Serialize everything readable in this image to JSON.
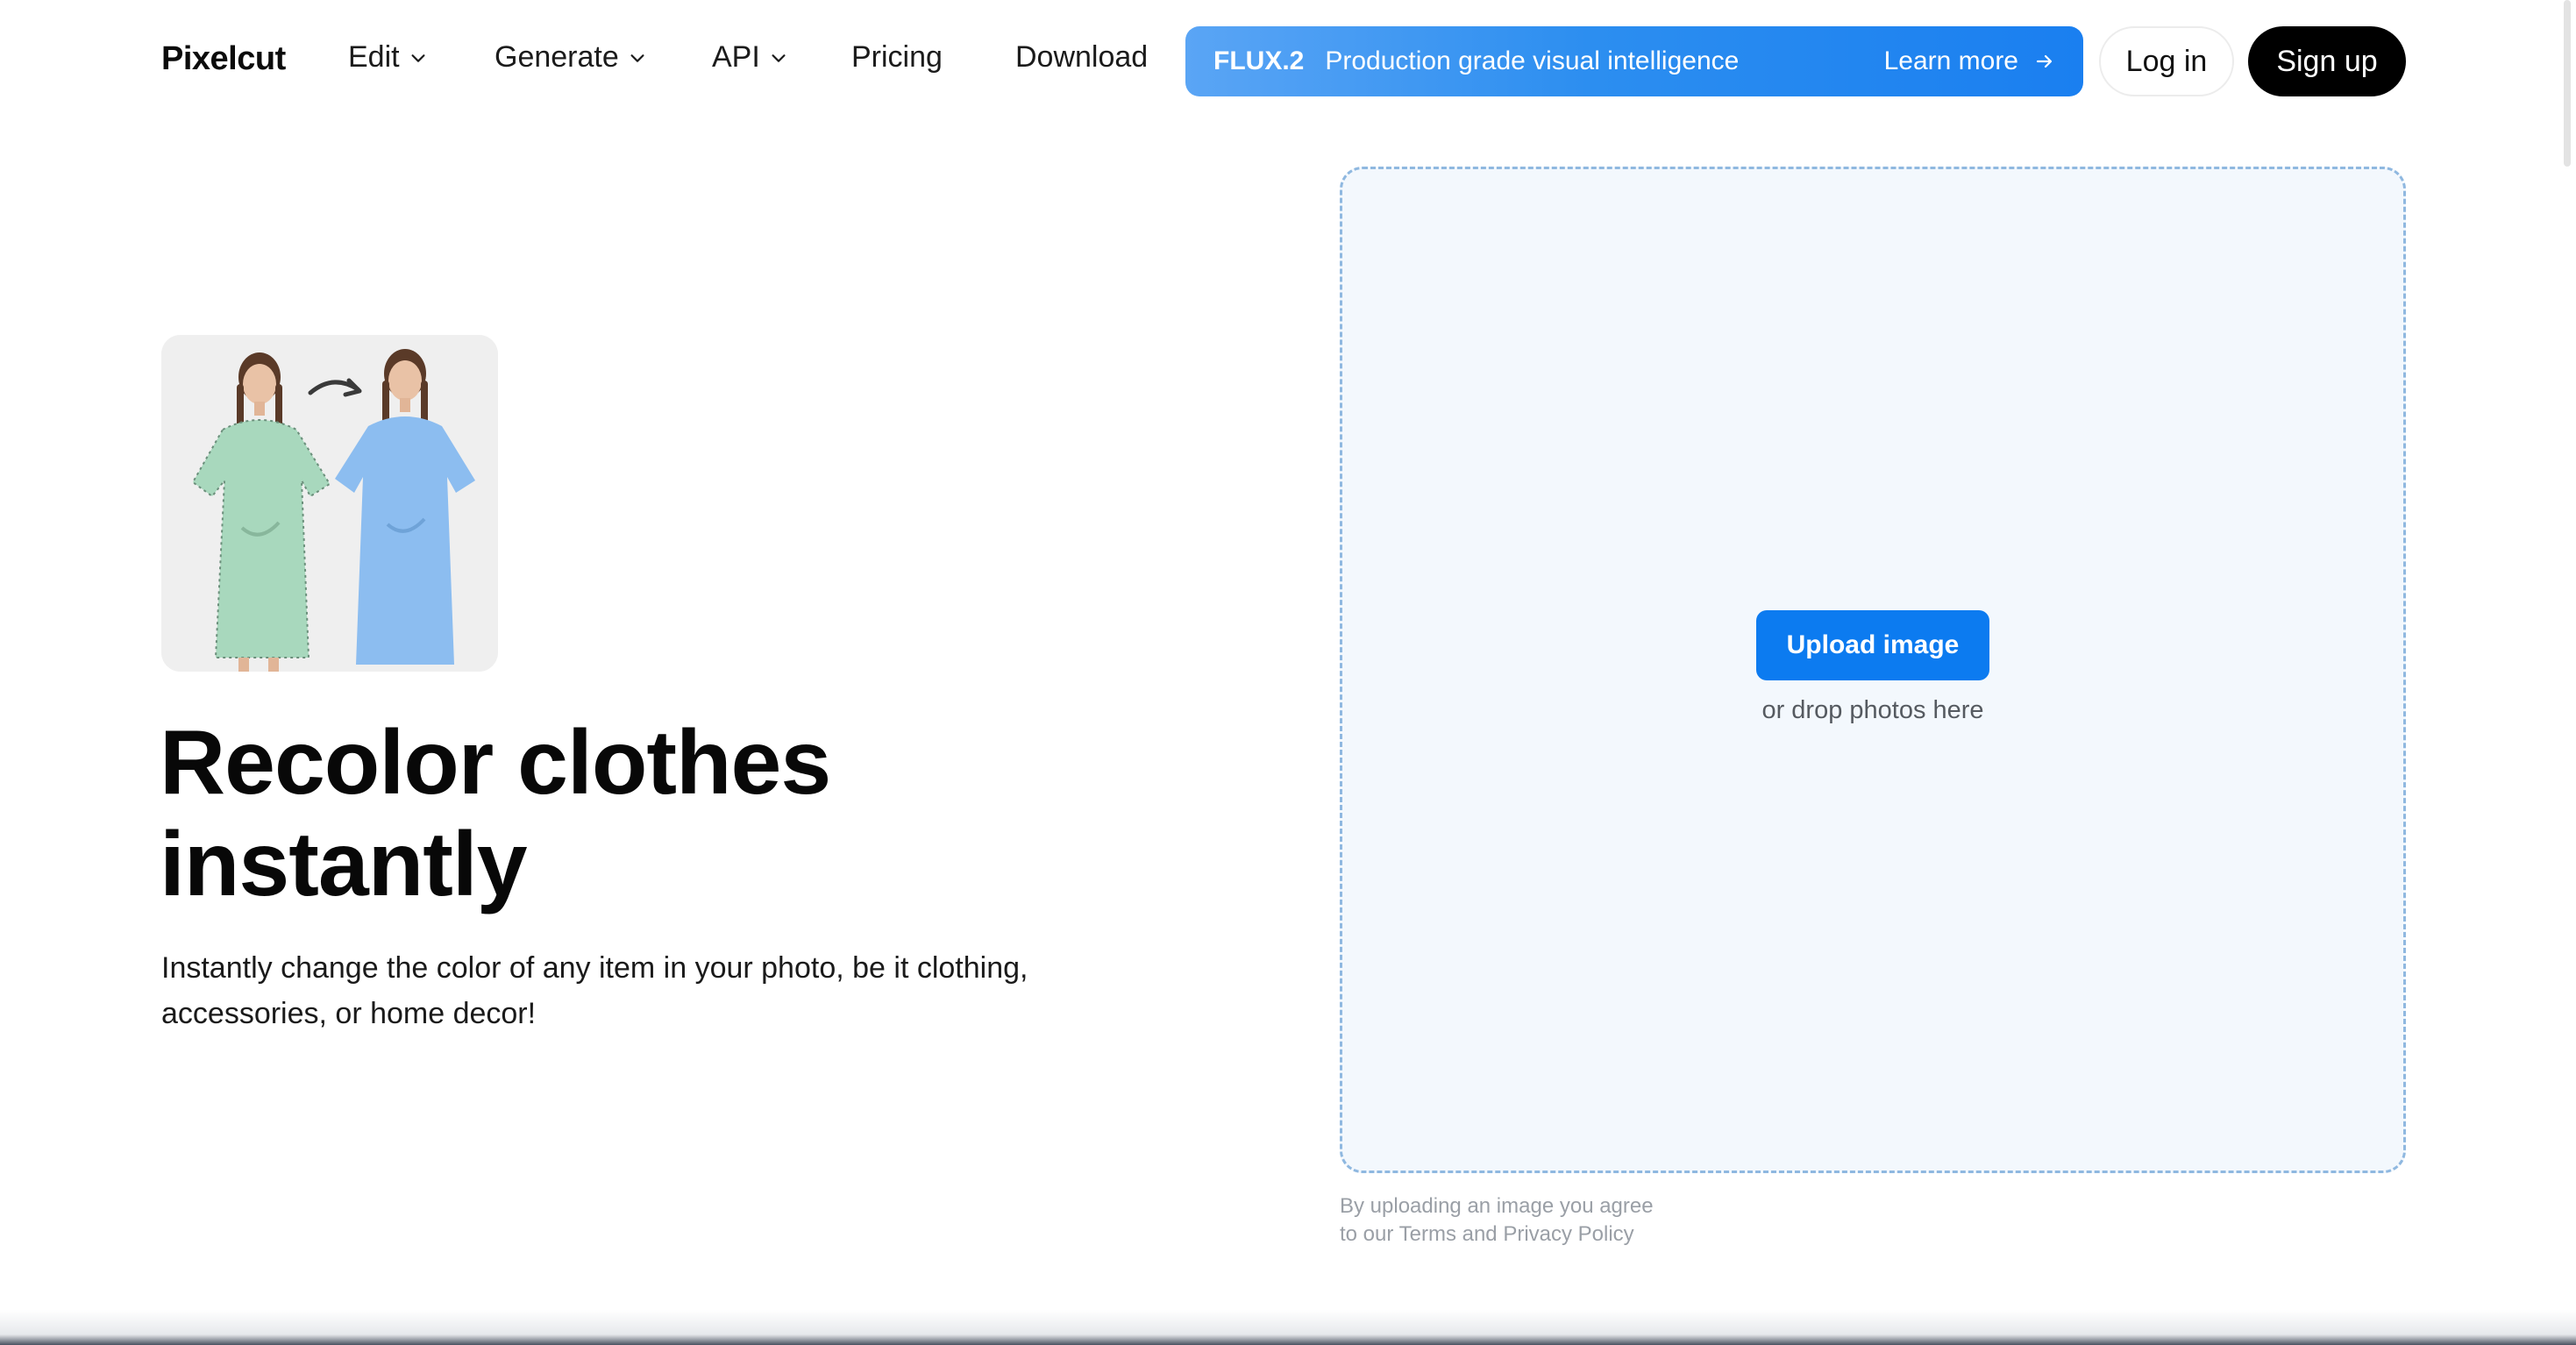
{
  "nav": {
    "brand": "Pixelcut",
    "items": [
      {
        "label": "Edit",
        "dropdown": true
      },
      {
        "label": "Generate",
        "dropdown": true
      },
      {
        "label": "API",
        "dropdown": true
      },
      {
        "label": "Pricing",
        "dropdown": false
      },
      {
        "label": "Download",
        "dropdown": false
      }
    ],
    "promo": {
      "tag": "FLUX.2",
      "text": "Production grade visual intelligence",
      "cta": "Learn more"
    },
    "login_label": "Log in",
    "signup_label": "Sign up"
  },
  "hero": {
    "title_line1": "Recolor clothes",
    "title_line2": "instantly",
    "description": "Instantly change the color of any item in your photo, be it clothing, accessories, or home decor!"
  },
  "upload": {
    "button_label": "Upload image",
    "hint": "or drop photos here",
    "legal_line1": "By uploading an image you agree",
    "legal_line2": "to our Terms and Privacy Policy"
  },
  "colors": {
    "accent": "#0c7bf0",
    "promo_start": "#5aa5f5",
    "promo_end": "#1a7ff0",
    "dropzone_bg": "#f3f8fd",
    "dress_before": "#a8d8bd",
    "dress_after": "#8cbdf0"
  },
  "icons": {
    "dropdown": "chevron-down-icon",
    "promo_arrow": "arrow-right-icon",
    "thumb_arrow": "curved-arrow-icon"
  }
}
